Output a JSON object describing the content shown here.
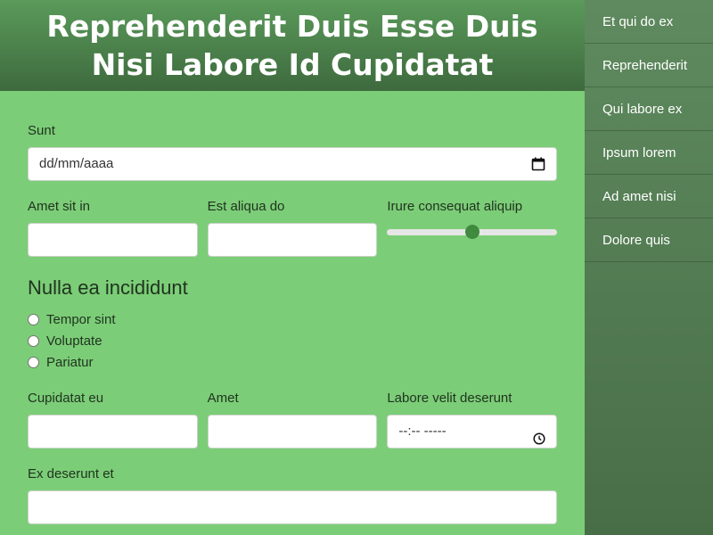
{
  "header": {
    "title": "Reprehenderit Duis Esse Duis Nisi Labore Id Cupidatat"
  },
  "sidebar": {
    "items": [
      {
        "label": "Et qui do ex"
      },
      {
        "label": "Reprehenderit"
      },
      {
        "label": "Qui labore ex"
      },
      {
        "label": "Ipsum lorem"
      },
      {
        "label": "Ad amet nisi"
      },
      {
        "label": "Dolore quis"
      }
    ]
  },
  "form": {
    "date_field": {
      "label": "Sunt",
      "placeholder": "dd/mm/aaaa"
    },
    "row1": {
      "field1": {
        "label": "Amet sit in",
        "value": ""
      },
      "field2": {
        "label": "Est aliqua do",
        "value": ""
      },
      "slider": {
        "label": "Irure consequat aliquip",
        "value": 0.5
      }
    },
    "radio_group": {
      "title": "Nulla ea incididunt",
      "options": [
        {
          "label": "Tempor sint"
        },
        {
          "label": "Voluptate"
        },
        {
          "label": "Pariatur"
        }
      ]
    },
    "row2": {
      "field1": {
        "label": "Cupidatat eu",
        "value": ""
      },
      "field2": {
        "label": "Amet",
        "value": ""
      },
      "time_field": {
        "label": "Labore velit deserunt",
        "placeholder": "--:-- -----"
      }
    },
    "textarea_field": {
      "label": "Ex deserunt et",
      "value": ""
    }
  },
  "icons": {
    "calendar": "calendar-icon",
    "clock": "clock-icon"
  },
  "colors": {
    "form_bg": "#7ccd77",
    "header_top": "#5a9a5a",
    "header_bottom": "#3e6a3e",
    "sidebar_bg": "#567d56",
    "slider_thumb": "#3f8a3f"
  }
}
